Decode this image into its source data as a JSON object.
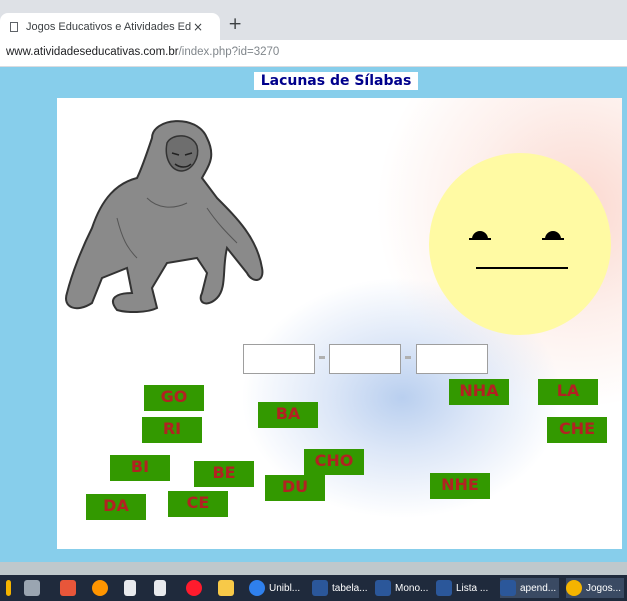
{
  "browser": {
    "tab_title": "Jogos Educativos e Atividades Ed",
    "tab_close": "×",
    "new_tab": "+",
    "url_host": "www.atividadeseducativas.com.br",
    "url_path": "/index.php?id=3270"
  },
  "game": {
    "title": "Lacunas de Sílabas",
    "slots": [
      "",
      "",
      ""
    ],
    "slot_separator": "-",
    "syllables": [
      "GO",
      "RI",
      "BI",
      "DA",
      "BE",
      "CE",
      "BA",
      "CHO",
      "DU",
      "NHA",
      "LA",
      "CHE",
      "NHE"
    ]
  },
  "taskbar": {
    "items": [
      "Unibl...",
      "tabela...",
      "Mono...",
      "Lista ...",
      "apend...",
      "Jogos..."
    ]
  },
  "colors": {
    "page_bg": "#87ceeb",
    "tile_bg": "#339900",
    "tile_text": "#b22222",
    "title_text": "#00008b",
    "sun": "#fffaa3"
  }
}
